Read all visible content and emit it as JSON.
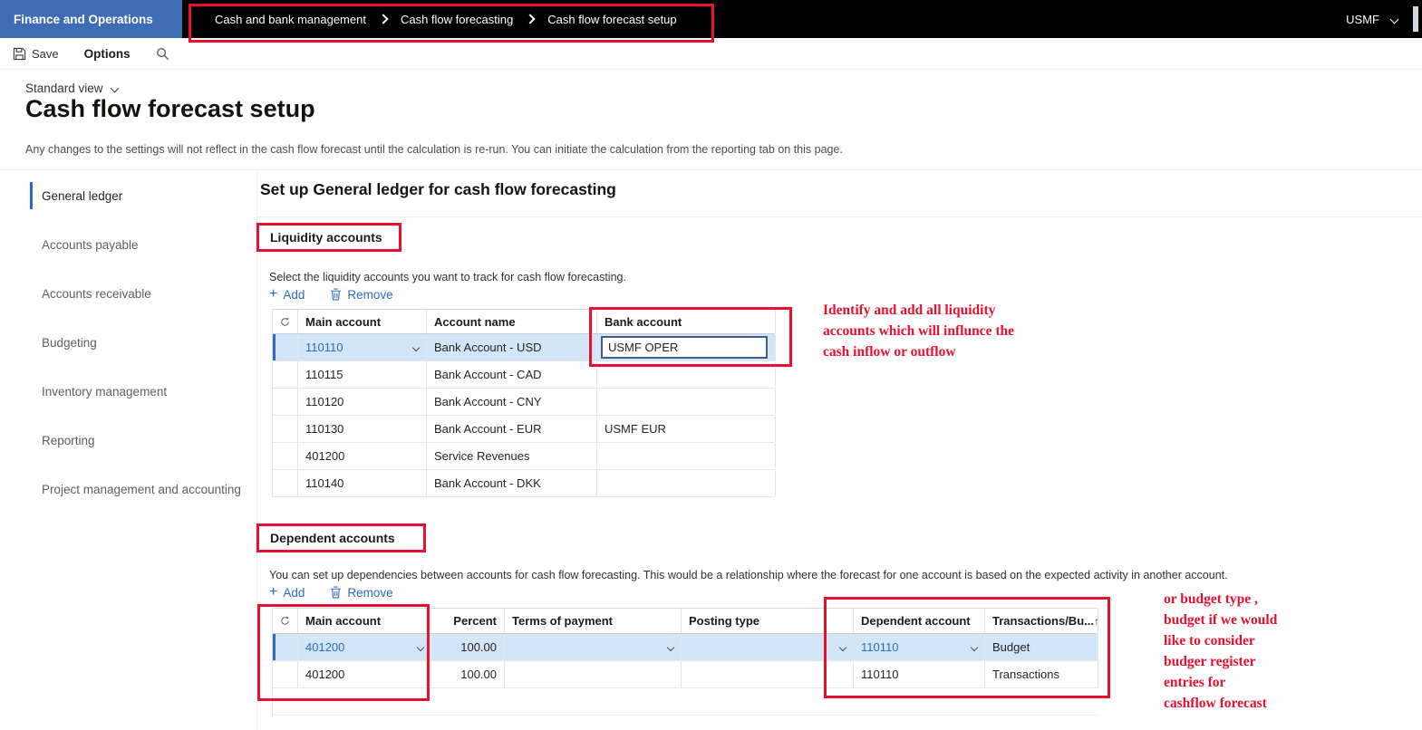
{
  "colors": {
    "accent": "#2b6bc0",
    "appblue": "#3e6db5",
    "annotation": "#e8112d",
    "selbg": "#d3e5f8",
    "topbar": "#000000"
  },
  "app": {
    "name": "Finance and Operations",
    "company": "USMF",
    "breadcrumb": [
      "Cash and bank management",
      "Cash flow forecasting",
      "Cash flow forecast setup"
    ]
  },
  "toolbar": {
    "save": "Save",
    "options": "Options"
  },
  "page": {
    "view_selector": "Standard view",
    "title": "Cash flow forecast setup",
    "notice": "Any changes to the settings will not reflect in the cash flow forecast until the calculation is re-run. You can initiate the calculation from the reporting tab on this page."
  },
  "sidebar": {
    "items": [
      {
        "label": "General ledger",
        "selected": true
      },
      {
        "label": "Accounts payable",
        "selected": false
      },
      {
        "label": "Accounts receivable",
        "selected": false
      },
      {
        "label": "Budgeting",
        "selected": false
      },
      {
        "label": "Inventory management",
        "selected": false
      },
      {
        "label": "Reporting",
        "selected": false
      },
      {
        "label": "Project management and accounting",
        "selected": false
      }
    ]
  },
  "main": {
    "heading": "Set up General ledger for cash flow forecasting",
    "liquidity": {
      "title": "Liquidity accounts",
      "description": "Select the liquidity accounts you want to track for cash flow forecasting.",
      "add_label": "Add",
      "remove_label": "Remove",
      "columns": [
        "Main account",
        "Account name",
        "Bank account"
      ],
      "rows": [
        {
          "main_account": "110110",
          "account_name": "Bank Account - USD",
          "bank_account": "USMF OPER",
          "selected": true
        },
        {
          "main_account": "110115",
          "account_name": "Bank Account - CAD",
          "bank_account": "",
          "selected": false
        },
        {
          "main_account": "110120",
          "account_name": "Bank Account - CNY",
          "bank_account": "",
          "selected": false
        },
        {
          "main_account": "110130",
          "account_name": "Bank Account - EUR",
          "bank_account": "USMF EUR",
          "selected": false
        },
        {
          "main_account": "401200",
          "account_name": "Service Revenues",
          "bank_account": "",
          "selected": false
        },
        {
          "main_account": "110140",
          "account_name": "Bank Account - DKK",
          "bank_account": "",
          "selected": false
        }
      ]
    },
    "dependent": {
      "title": "Dependent accounts",
      "description": "You can set up dependencies between accounts for cash flow forecasting. This would be a relationship where the forecast for one account is based on the expected activity in another account.",
      "add_label": "Add",
      "remove_label": "Remove",
      "columns": [
        "Main account",
        "Percent",
        "Terms of payment",
        "Posting type",
        "Dependent account",
        "Transactions/Bu..."
      ],
      "sort_indicator": "↑",
      "rows": [
        {
          "main_account": "401200",
          "percent": "100.00",
          "terms_of_payment": "",
          "posting_type": "",
          "dependent_account": "110110",
          "transactions_budget": "Budget",
          "selected": true
        },
        {
          "main_account": "401200",
          "percent": "100.00",
          "terms_of_payment": "",
          "posting_type": "",
          "dependent_account": "110110",
          "transactions_budget": "Transactions",
          "selected": false
        }
      ]
    }
  },
  "annotations": {
    "liquidity_note": [
      "Identify and add all liquidity",
      "accounts which will influnce the",
      "cash inflow or outflow"
    ],
    "dependent_note": [
      "or budget type ,",
      "budget if we would",
      "like to consider",
      "budger register",
      "entries for",
      "cashflow forecast"
    ]
  }
}
